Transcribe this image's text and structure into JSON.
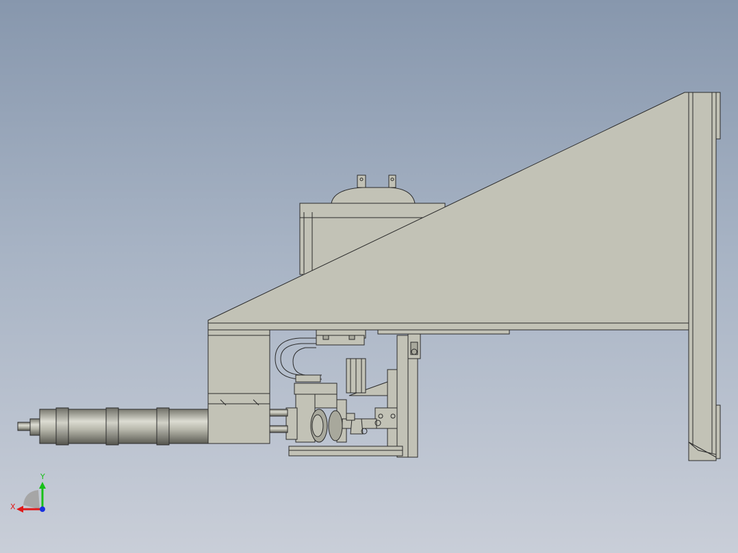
{
  "triad": {
    "x_label": "X",
    "y_label": "Y",
    "x_color": "#e01818",
    "y_color": "#18c018",
    "z_color": "#1830e0"
  },
  "colors": {
    "background_top": "#8797ad",
    "background_bottom": "#c9ced8",
    "part_fill": "#c2c2b6",
    "part_shadow": "#a8a89c",
    "edge": "#2a2a2a"
  }
}
